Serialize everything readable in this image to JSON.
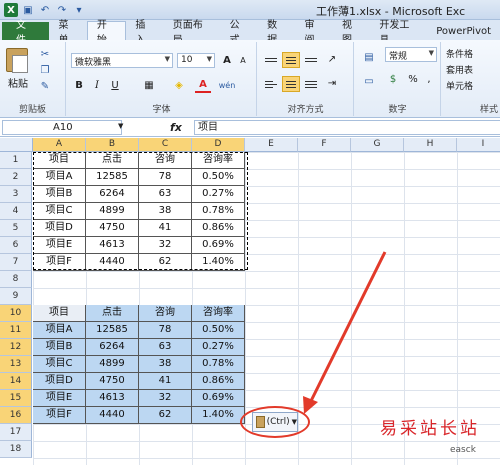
{
  "window": {
    "title": "工作薄1.xlsx - Microsoft Exc"
  },
  "tabs": [
    "文件",
    "菜单",
    "开始",
    "插入",
    "页面布局",
    "公式",
    "数据",
    "审阅",
    "视图",
    "开发工具",
    "PowerPivot"
  ],
  "ribbon": {
    "clipboard": {
      "paste_label": "粘贴",
      "group_label": "剪贴板"
    },
    "font": {
      "name": "微软雅黑",
      "size": "10",
      "bold": "B",
      "italic": "I",
      "underline": "U",
      "grow": "A",
      "shrink": "A",
      "wen": "wén",
      "group_label": "字体"
    },
    "alignment": {
      "group_label": "对齐方式"
    },
    "number": {
      "format": "常规",
      "group_label": "数字",
      "percent": "%",
      "comma": ","
    },
    "styles": {
      "cond_format": "条件格",
      "table_format": "套用表",
      "cell_style": "单元格",
      "group_label": "样式"
    }
  },
  "formula_bar": {
    "name_box": "A10",
    "fx": "fx",
    "value": "项目"
  },
  "columns": [
    "A",
    "B",
    "C",
    "D",
    "E",
    "F",
    "G",
    "H",
    "I"
  ],
  "rows": [
    "1",
    "2",
    "3",
    "4",
    "5",
    "6",
    "7",
    "8",
    "9",
    "10",
    "11",
    "12",
    "13",
    "14",
    "15",
    "16",
    "17",
    "18"
  ],
  "table1": {
    "headers": [
      "项目",
      "点击",
      "咨询",
      "咨询率"
    ],
    "rows": [
      [
        "项目A",
        "12585",
        "78",
        "0.50%"
      ],
      [
        "项目B",
        "6264",
        "63",
        "0.27%"
      ],
      [
        "项目C",
        "4899",
        "38",
        "0.78%"
      ],
      [
        "项目D",
        "4750",
        "41",
        "0.86%"
      ],
      [
        "项目E",
        "4613",
        "32",
        "0.69%"
      ],
      [
        "项目F",
        "4440",
        "62",
        "1.40%"
      ]
    ]
  },
  "table2": {
    "headers": [
      "项目",
      "点击",
      "咨询",
      "咨询率"
    ],
    "rows": [
      [
        "项目A",
        "12585",
        "78",
        "0.50%"
      ],
      [
        "项目B",
        "6264",
        "63",
        "0.27%"
      ],
      [
        "项目C",
        "4899",
        "38",
        "0.78%"
      ],
      [
        "项目D",
        "4750",
        "41",
        "0.86%"
      ],
      [
        "项目E",
        "4613",
        "32",
        "0.69%"
      ],
      [
        "项目F",
        "4440",
        "62",
        "1.40%"
      ]
    ]
  },
  "paste_options": {
    "label": "(Ctrl)"
  },
  "watermark": {
    "text": "易采站长站",
    "sub": "easck"
  },
  "colors": {
    "selection": "#bcd7f2",
    "annotation": "#e23a2a",
    "header_selected": "#f9d477"
  }
}
